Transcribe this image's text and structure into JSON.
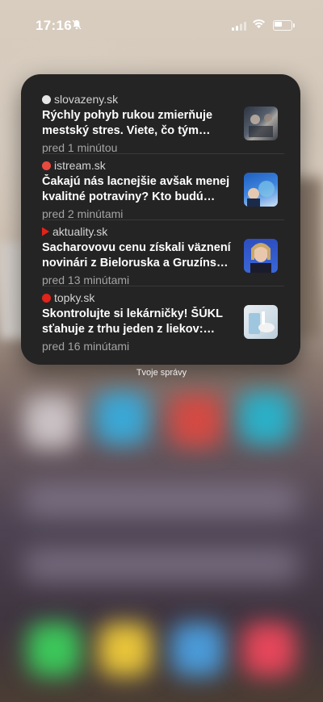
{
  "status_bar": {
    "time": "17:16"
  },
  "widget": {
    "label": "Tvoje správy",
    "items": [
      {
        "source": "slovazeny.sk",
        "title": "Rýchly pohyb rukou zmierňuje mestský stres. Viete, čo tým ľudia…",
        "time": "pred 1 minútou",
        "logo_color": "#e6e6e6"
      },
      {
        "source": "istream.sk",
        "title": "Čakajú nás lacnejšie avšak menej kvalitné potraviny? Kto budú víťazi a…",
        "time": "pred 2 minútami",
        "logo_color": "#e84a3f"
      },
      {
        "source": "aktuality.sk",
        "title": "Sacharovovu cenu získali väznení novinári z Bieloruska a Gruzínska, R…",
        "time": "pred 13 minútami",
        "logo_color": "#e2231a"
      },
      {
        "source": "topky.sk",
        "title": "Skontrolujte si lekárničky! ŠÚKL sťahuje z trhu jeden z liekov: Týmto…",
        "time": "pred 16 minútami",
        "logo_color": "#e2231a"
      }
    ]
  }
}
